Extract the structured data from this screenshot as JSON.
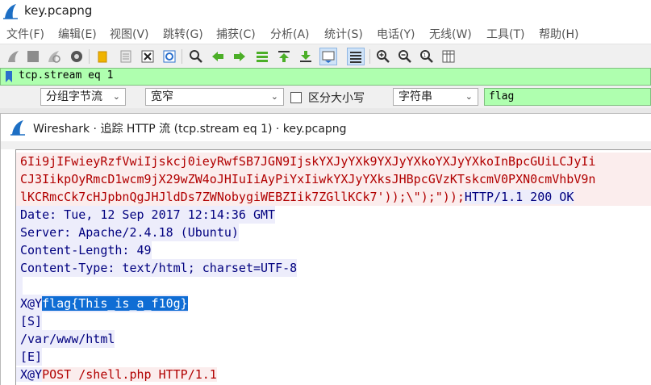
{
  "window": {
    "title": "key.pcapng"
  },
  "menu": [
    "文件(F)",
    "编辑(E)",
    "视图(V)",
    "跳转(G)",
    "捕获(C)",
    "分析(A)",
    "统计(S)",
    "电话(Y)",
    "无线(W)",
    "工具(T)",
    "帮助(H)"
  ],
  "toolbar_icons": [
    "start-capture-icon",
    "stop-capture-icon",
    "restart-capture-icon",
    "capture-options-icon",
    "open-file-icon",
    "save-file-icon",
    "close-file-icon",
    "reload-file-icon",
    "find-packet-icon",
    "go-back-icon",
    "go-forward-icon",
    "go-to-packet-icon",
    "go-first-icon",
    "go-last-icon",
    "autoscroll-icon",
    "colorize-icon",
    "zoom-in-icon",
    "zoom-out-icon",
    "normal-size-icon",
    "resize-columns-icon"
  ],
  "filter": {
    "value": "tcp.stream eq 1"
  },
  "find": {
    "search_in": "分组字节流",
    "char_width": "宽窄",
    "case_label": "区分大小写",
    "case_checked": false,
    "search_type": "字符串",
    "query": "flag"
  },
  "dialog": {
    "title": "Wireshark · 追踪 HTTP 流 (tcp.stream eq 1) · key.pcapng"
  },
  "stream_lines": [
    {
      "dir": "client",
      "text": "6Ii9jIFwieyRzfVwiIjskcj0ieyRwfSB7JGN9IjskYXJyYXk9YXJyYXkoYXJyYXkoInBpcGUiLCJyIi"
    },
    {
      "dir": "client",
      "text": "CJ3IikpOyRmcD1wcm9jX29wZW4oJHIuIiAyPiYxIiwkYXJyYXksJHBpcGVzKTskcmV0PXN0cmVhbV9n"
    },
    {
      "dir": "client",
      "text": "lKCRmcCk7cHJpbnQgJHJldDs7ZWNobygiWEBZIik7ZGllKCk7'));\\\");\"));",
      "tail": "HTTP/1.1 200 OK"
    },
    {
      "dir": "server",
      "text": "Date: Tue, 12 Sep 2017 12:14:36 GMT"
    },
    {
      "dir": "server",
      "text": "Server: Apache/2.4.18 (Ubuntu)"
    },
    {
      "dir": "server",
      "text": "Content-Length: 49"
    },
    {
      "dir": "server",
      "text": "Content-Type: text/html; charset=UTF-8"
    },
    {
      "dir": "server",
      "text": ""
    },
    {
      "dir": "server",
      "text": "X@Y",
      "highlight": "flag{This_is_a_f10g}"
    },
    {
      "dir": "server",
      "text": "[S]"
    },
    {
      "dir": "server",
      "text": "/var/www/html"
    },
    {
      "dir": "server",
      "text": "[E]"
    },
    {
      "dir": "server",
      "text": "X@Y",
      "tail_client": "POST /shell.php HTTP/1.1"
    }
  ]
}
